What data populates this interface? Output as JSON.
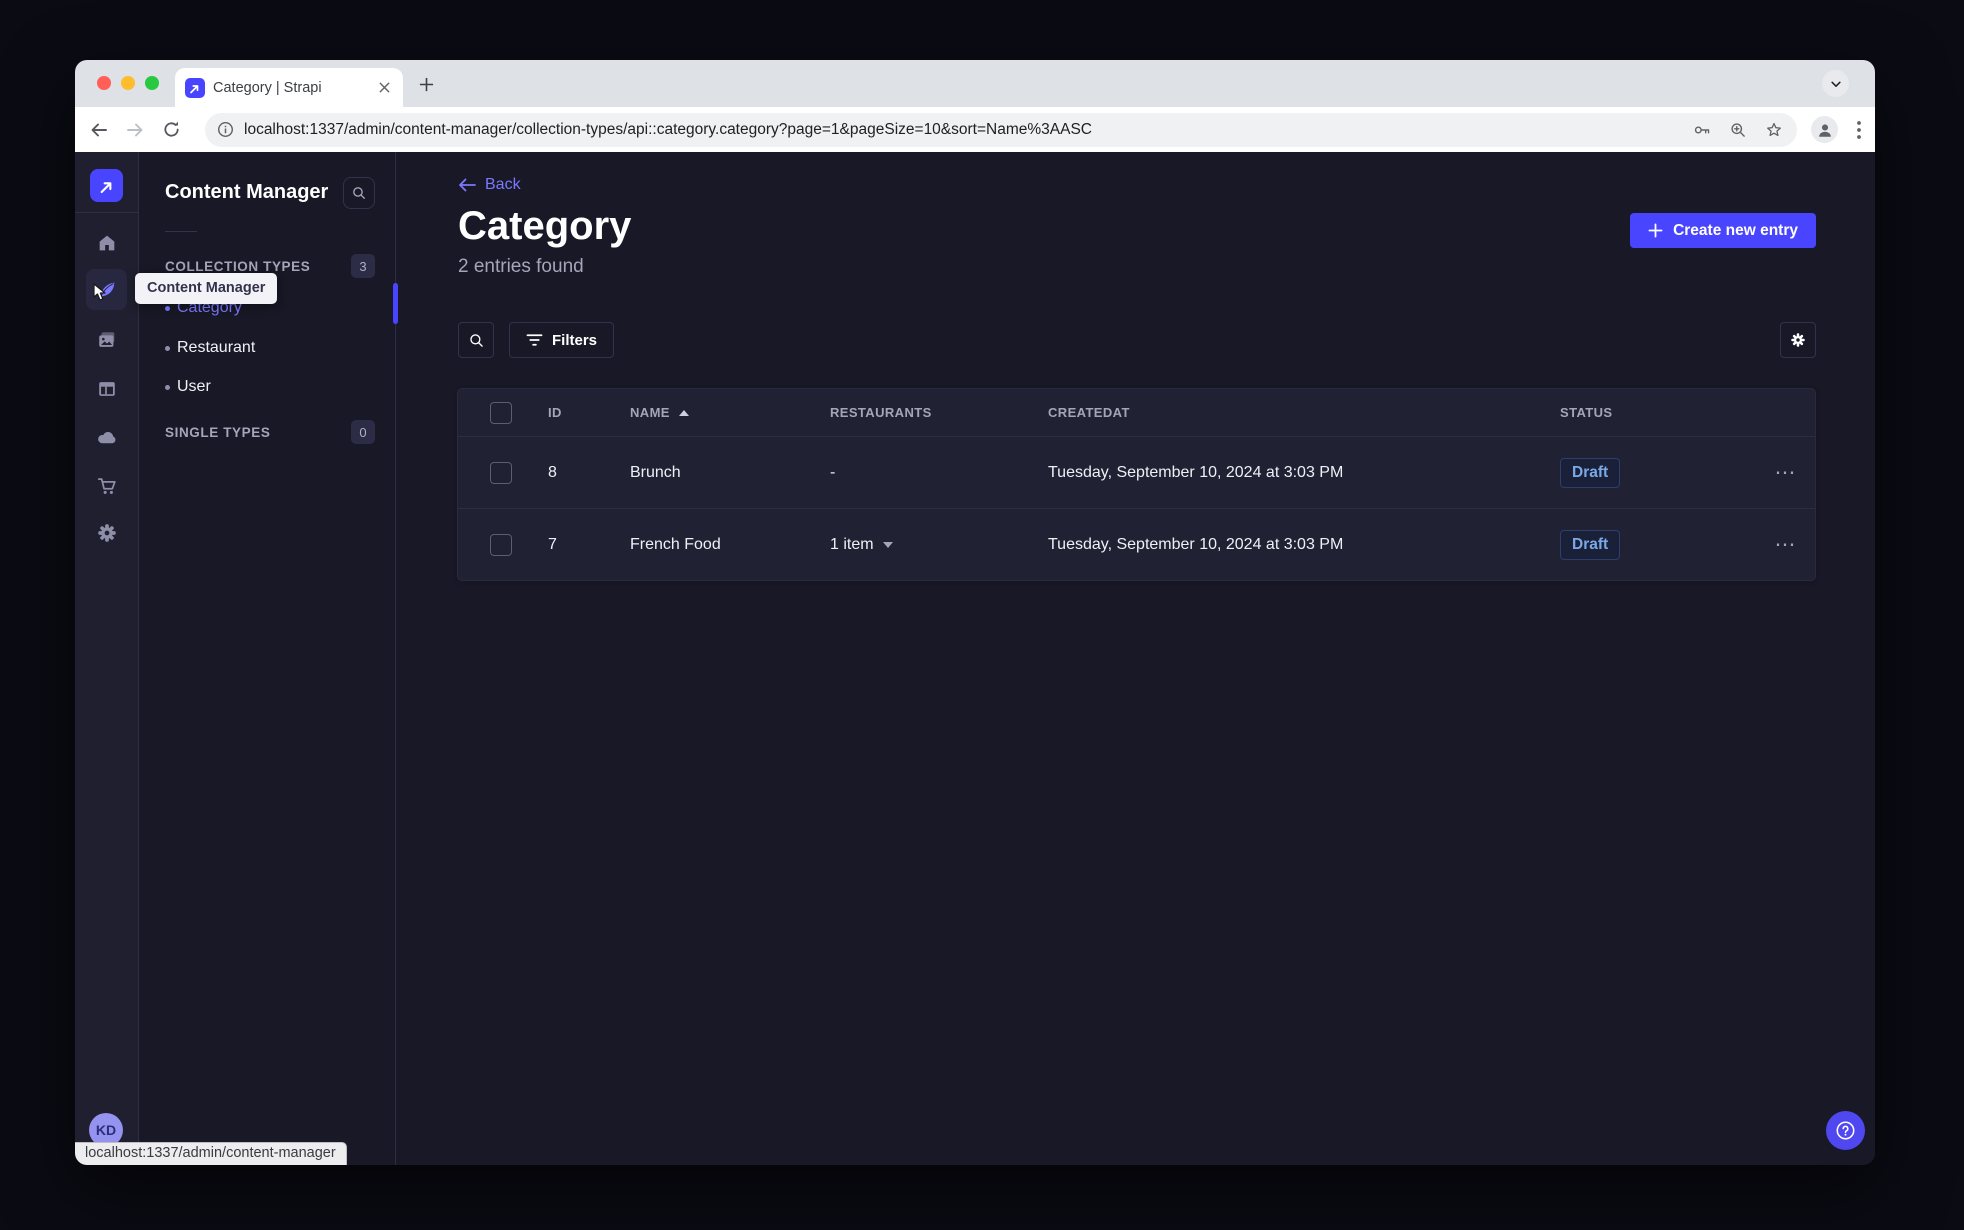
{
  "browser": {
    "tab_title": "Category | Strapi",
    "url": "localhost:1337/admin/content-manager/collection-types/api::category.category?page=1&pageSize=10&sort=Name%3AASC",
    "status_bar_url": "localhost:1337/admin/content-manager"
  },
  "rail": {
    "tooltip": "Content Manager",
    "avatar_initials": "KD"
  },
  "sidebar": {
    "title": "Content Manager",
    "sections": [
      {
        "label": "COLLECTION TYPES",
        "count": "3",
        "items": [
          {
            "label": "Category"
          },
          {
            "label": "Restaurant"
          },
          {
            "label": "User"
          }
        ]
      },
      {
        "label": "SINGLE TYPES",
        "count": "0",
        "items": []
      }
    ]
  },
  "main": {
    "back_label": "Back",
    "title": "Category",
    "subtitle": "2 entries found",
    "create_button_label": "Create new entry",
    "filters_button_label": "Filters",
    "table": {
      "columns": [
        "ID",
        "NAME",
        "RESTAURANTS",
        "CREATEDAT",
        "STATUS"
      ],
      "sorted_column": "NAME",
      "sort_direction": "ascending",
      "row_actions_label": "⋯",
      "rows": [
        {
          "id": "8",
          "name": "Brunch",
          "restaurants": "-",
          "createdat": "Tuesday, September 10, 2024 at 3:03 PM",
          "status": "Draft"
        },
        {
          "id": "7",
          "name": "French Food",
          "restaurants": "1 item",
          "createdat": "Tuesday, September 10, 2024 at 3:03 PM",
          "status": "Draft"
        }
      ]
    }
  },
  "colors": {
    "primary": "#4945ff",
    "primary_light": "#7b79ff",
    "draft_text": "#7ba9e8"
  }
}
